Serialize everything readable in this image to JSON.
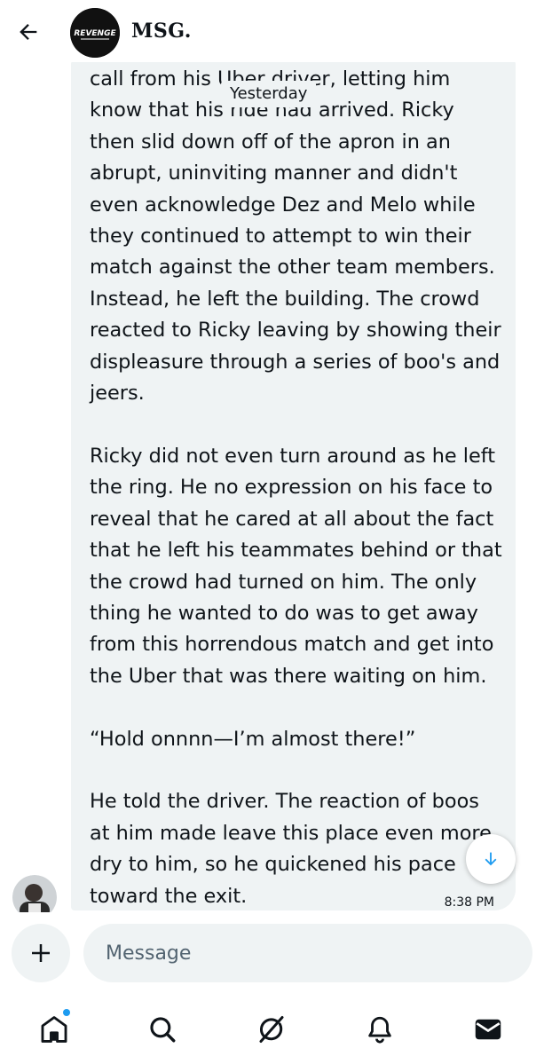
{
  "header": {
    "title": "MSG.",
    "avatar_text": "REVENGE",
    "back_icon": "arrow-left-icon"
  },
  "conversation": {
    "day_separator": "Yesterday",
    "message": {
      "text": "call from his Uber driver, letting him\nknow that his ride had arrived. Ricky\nthen slid down off of the apron in an\nabrupt, uninviting manner and didn't\neven acknowledge Dez and Melo while\nthey continued to attempt to win their\nmatch against the other team members.\nInstead, he left the building. The crowd\nreacted to Ricky leaving by showing their\ndispleasure through a series of boo's and\njeers.\n\nRicky did not even turn around as he left\nthe ring. He no expression on his face to\nreveal that he cared at all about the fact\nthat he left his teammates behind or that\nthe crowd had turned on him. The only\nthing he wanted to do was to get away\nfrom this horrendous match and get into\nthe Uber that was there waiting on him.\n\n“Hold onnnn—I’m almost there!”\n\nHe told the driver. The reaction of boos\nat him made leave this place even more\ndry to him, so he quickened his pace\ntoward the exit.",
      "time": "8:38 PM"
    },
    "scroll_down_icon": "arrow-down-icon"
  },
  "composer": {
    "placeholder": "Message",
    "add_icon": "plus-icon"
  },
  "bottom_nav": {
    "items": [
      "home-icon",
      "search-icon",
      "grok-icon",
      "bell-icon",
      "mail-icon"
    ],
    "notification_dot_color": "#1d9bf0"
  },
  "colors": {
    "bubble": "#eff3f4",
    "accent": "#1d9bf0",
    "text": "#0f1419",
    "muted": "#536471"
  }
}
